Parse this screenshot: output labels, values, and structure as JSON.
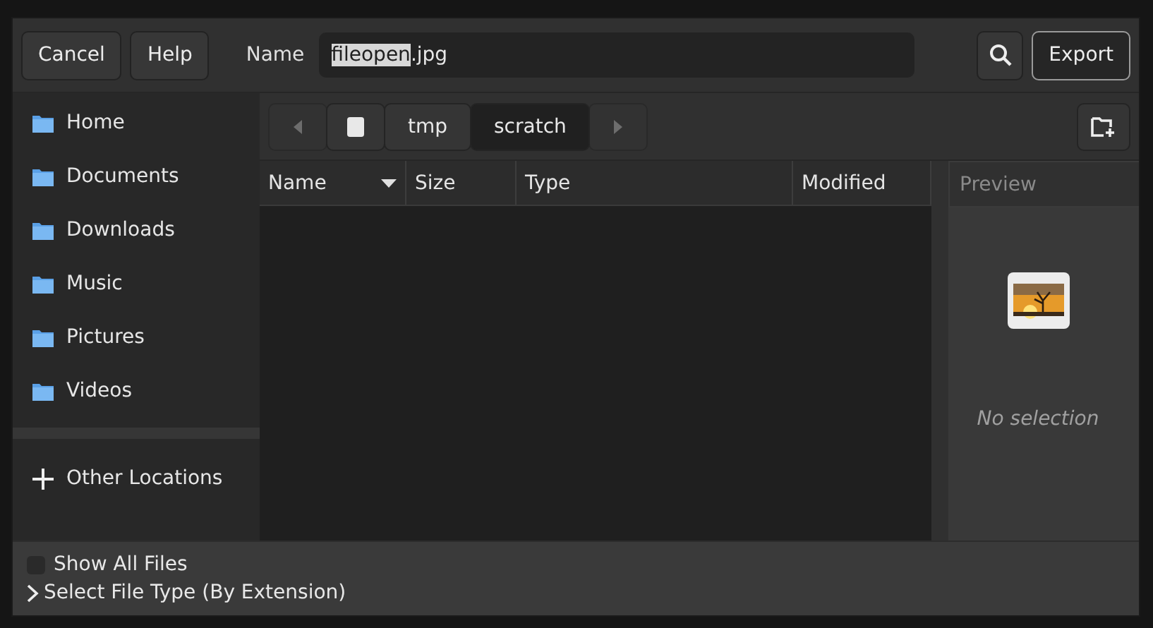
{
  "header": {
    "buttons": [
      {
        "label": "Cancel"
      },
      {
        "label": "Help"
      }
    ],
    "name_label": "Name",
    "name_field": {
      "selected_part": "fileopen",
      "rest": ".jpg"
    },
    "export_label": "Export"
  },
  "sidebar": {
    "places": [
      {
        "label": "Home"
      },
      {
        "label": "Documents"
      },
      {
        "label": "Downloads"
      },
      {
        "label": "Music"
      },
      {
        "label": "Pictures"
      },
      {
        "label": "Videos"
      }
    ],
    "other_locations": "Other Locations"
  },
  "path_bar": {
    "back_disabled": true,
    "forward_disabled": true,
    "crumbs": [
      {
        "kind": "drive",
        "selected": false
      },
      {
        "kind": "text",
        "label": "tmp",
        "selected": false
      },
      {
        "kind": "text",
        "label": "scratch",
        "selected": true
      }
    ]
  },
  "table": {
    "columns": [
      {
        "label": "Name",
        "sorted": true
      },
      {
        "label": "Size",
        "sorted": false
      },
      {
        "label": "Type",
        "sorted": false
      },
      {
        "label": "Modified",
        "sorted": false
      }
    ]
  },
  "preview": {
    "title": "Preview",
    "message": "No selection"
  },
  "footer": {
    "show_all_files": {
      "label": "Show All Files",
      "checked": false
    },
    "file_type": {
      "label": "Select File Type (By Extension)",
      "expanded": false
    }
  }
}
